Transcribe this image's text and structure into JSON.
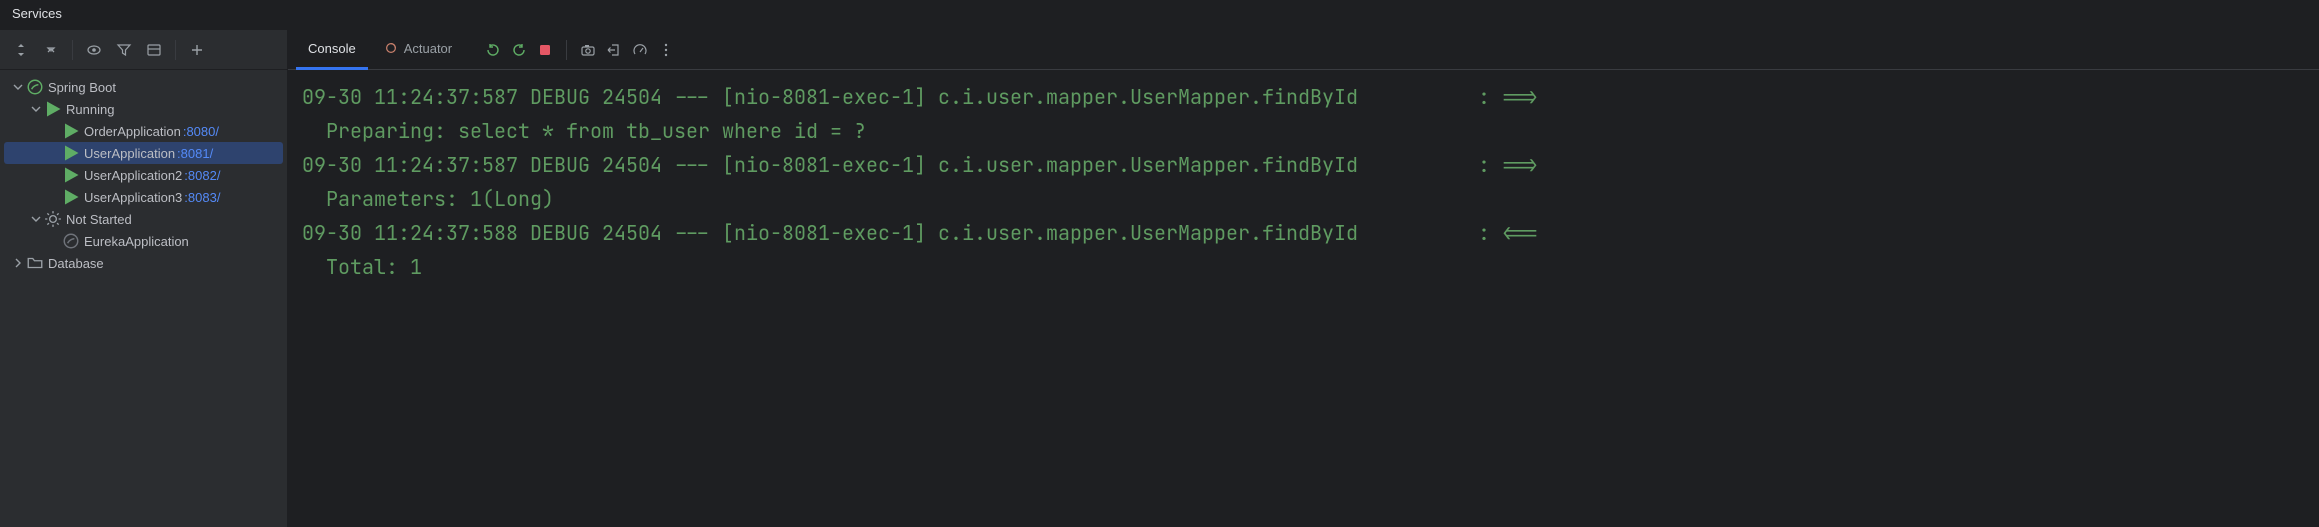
{
  "title": "Services",
  "sidebar": {
    "toolbar_icons": [
      "expand-collapse",
      "collapse",
      "eye",
      "filter",
      "layout",
      "add"
    ],
    "tree": {
      "springboot_label": "Spring Boot",
      "running_label": "Running",
      "apps": [
        {
          "name": "OrderApplication",
          "port": ":8080/"
        },
        {
          "name": "UserApplication",
          "port": ":8081/"
        },
        {
          "name": "UserApplication2",
          "port": ":8082/"
        },
        {
          "name": "UserApplication3",
          "port": ":8083/"
        }
      ],
      "notstarted_label": "Not Started",
      "notstarted_apps": [
        {
          "name": "EurekaApplication"
        }
      ],
      "database_label": "Database"
    }
  },
  "tabs": {
    "console": "Console",
    "actuator": "Actuator"
  },
  "console_lines": [
    {
      "ts": "09-30 11:24:37:587",
      "level": "DEBUG",
      "pid": "24504",
      "thread": "[nio-8081-exec-1]",
      "logger": "c.i.user.mapper.UserMapper.findById",
      "sep": ":",
      "arrow": "==>"
    },
    {
      "sub": " Preparing: select * from tb_user where id = ?"
    },
    {
      "ts": "09-30 11:24:37:587",
      "level": "DEBUG",
      "pid": "24504",
      "thread": "[nio-8081-exec-1]",
      "logger": "c.i.user.mapper.UserMapper.findById",
      "sep": ":",
      "arrow": "==>"
    },
    {
      "sub": " Parameters: 1(Long)"
    },
    {
      "ts": "09-30 11:24:37:588",
      "level": "DEBUG",
      "pid": "24504",
      "thread": "[nio-8081-exec-1]",
      "logger": "c.i.user.mapper.UserMapper.findById",
      "sep": ":",
      "arrow": "<=="
    },
    {
      "sub": " Total: 1"
    }
  ]
}
